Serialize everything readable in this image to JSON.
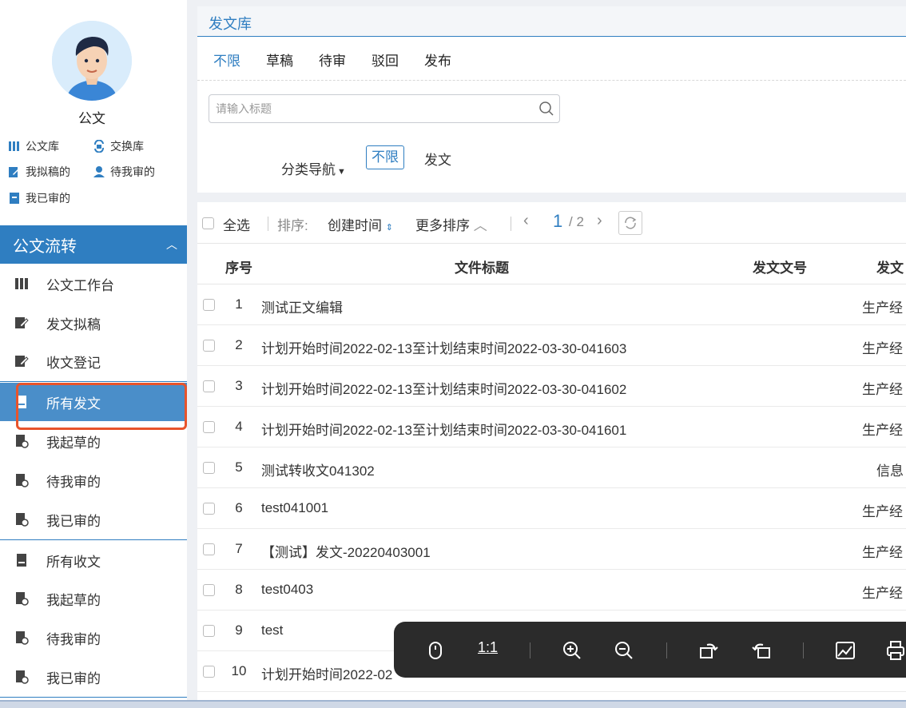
{
  "profile": {
    "name": "公文"
  },
  "quick_links": [
    {
      "label": "公文库",
      "icon": "library-icon"
    },
    {
      "label": "交换库",
      "icon": "exchange-icon"
    },
    {
      "label": "我拟稿的",
      "icon": "edit-doc-icon"
    },
    {
      "label": "待我审的",
      "icon": "user-icon"
    },
    {
      "label": "我已审的",
      "icon": "archive-icon"
    }
  ],
  "section": {
    "title": "公文流转"
  },
  "nav": [
    {
      "label": "公文工作台"
    },
    {
      "label": "发文拟稿"
    },
    {
      "label": "收文登记"
    },
    {
      "label": "所有发文"
    },
    {
      "label": "我起草的"
    },
    {
      "label": "待我审的"
    },
    {
      "label": "我已审的"
    },
    {
      "label": "所有收文"
    },
    {
      "label": "我起草的"
    },
    {
      "label": "待我审的"
    },
    {
      "label": "我已审的"
    }
  ],
  "page_title": "发文库",
  "status_tabs": [
    "不限",
    "草稿",
    "待审",
    "驳回",
    "发布"
  ],
  "search": {
    "placeholder": "请输入标题"
  },
  "category": {
    "label": "分类导航",
    "options": [
      "不限",
      "发文"
    ]
  },
  "toolbar": {
    "select_all": "全选",
    "sort_label": "排序:",
    "sort_field": "创建时间",
    "more_sort": "更多排序",
    "page_current": "1",
    "page_total": "/ 2"
  },
  "table": {
    "headers": [
      "序号",
      "文件标题",
      "发文文号",
      "发文"
    ],
    "rows": [
      {
        "no": "1",
        "title": "测试正文编辑",
        "dept": "生产经"
      },
      {
        "no": "2",
        "title": "计划开始时间2022-02-13至计划结束时间2022-03-30-041603",
        "dept": "生产经"
      },
      {
        "no": "3",
        "title": "计划开始时间2022-02-13至计划结束时间2022-03-30-041602",
        "dept": "生产经"
      },
      {
        "no": "4",
        "title": "计划开始时间2022-02-13至计划结束时间2022-03-30-041601",
        "dept": "生产经"
      },
      {
        "no": "5",
        "title": "测试转收文041302",
        "dept": "信息"
      },
      {
        "no": "6",
        "title": "test041001",
        "dept": "生产经"
      },
      {
        "no": "7",
        "title": "【测试】发文-20220403001",
        "dept": "生产经"
      },
      {
        "no": "8",
        "title": "test0403",
        "dept": "生产经"
      },
      {
        "no": "9",
        "title": "test",
        "dept": ""
      },
      {
        "no": "10",
        "title": "计划开始时间2022-02",
        "dept": ""
      }
    ]
  },
  "viewer": {
    "ratio_label": "1:1"
  },
  "colors": {
    "accent": "#2f7ec1",
    "active_nav": "#4a8ec9",
    "highlight": "#e8542c"
  }
}
